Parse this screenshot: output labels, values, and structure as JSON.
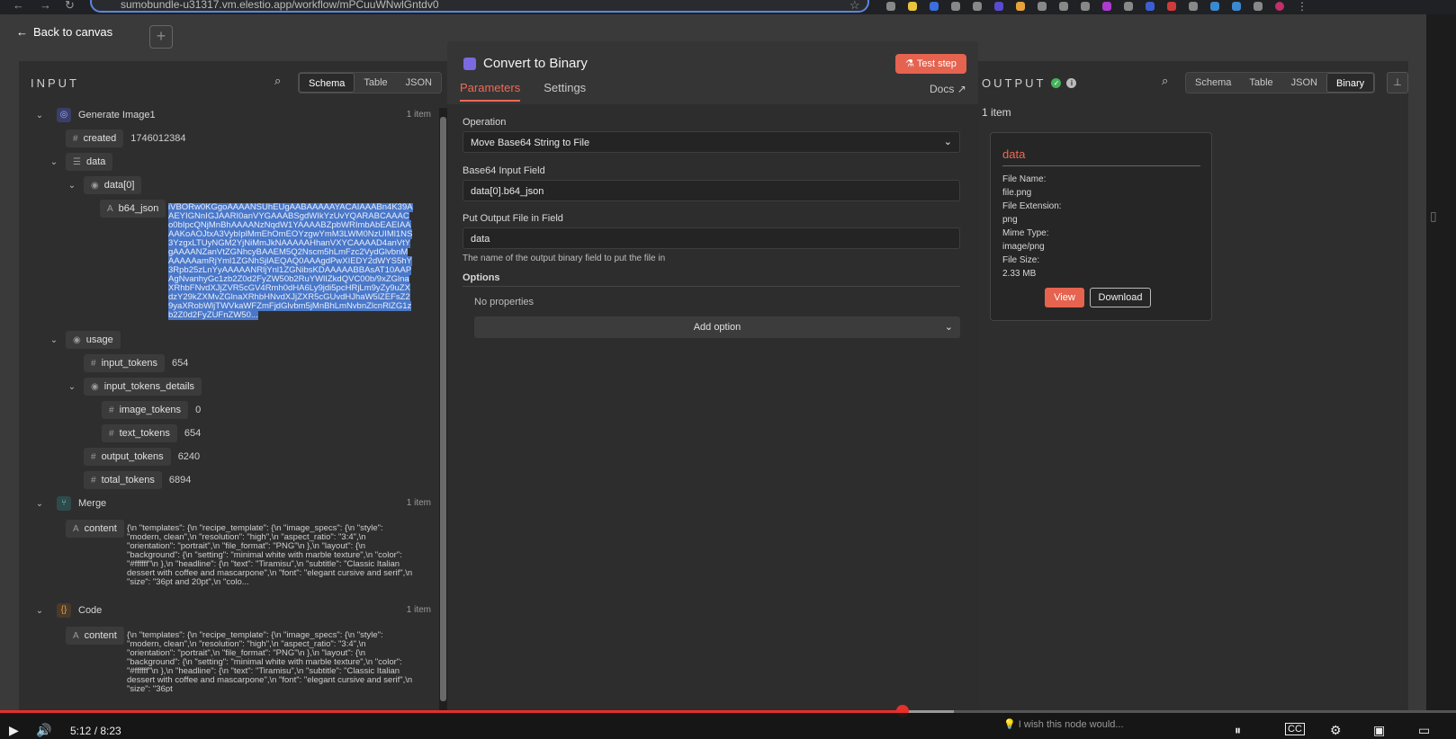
{
  "browser": {
    "url": "sumobundle-u31317.vm.elestio.app/workflow/mPCuuWNwlGntdv0"
  },
  "canvas": {
    "back_label": "Back to canvas"
  },
  "input_panel": {
    "title": "INPUT",
    "view_tabs": [
      "Schema",
      "Table",
      "JSON"
    ],
    "active_view": "Schema",
    "nodes": [
      {
        "name": "Generate Image1",
        "count": "1 item",
        "fields": {
          "created_key": "created",
          "created_val": "1746012384",
          "data_key": "data",
          "data0_key": "data[0]",
          "b64_key": "b64_json",
          "b64_val": "iVBORw0KGgoAAAANSUhEUgAABAAAAAYACAIAAABn4K39AAEYIGNnIGJAARI0anVYGAAABSgdWIkYzUvYQARABCAAACo0bIpcQNjMnBhAAAANzNqdW1YAAAABZpbWRImbAbEAEIAAAAKoAOJtxA3VybIplMmEhOmEOYzgwYmM3LWM0NzUIMl1NS3YzgxLTUyNGM2YjNiMmJkNAAAAAHhanVXYCAAAAD4anVtYgAAAANZanVtZGNhcyBAAEM5Q2Nscm5hLmFzc2VydGlvbnMAAAAAamRjYml1ZGNhSjlAEQAQ0AAAgdPwXIEDY2dWYS5hY3Rpb25zLnYyAAAAANRljYnl1ZGNibsKDAAAAABBAsAT10AAPAgNvanhyGc1zb2Z0d2FyZW50b2RuYWlIZkdQVC00b/9xZGlnaXRhbFNvdXJjZVR5cGV4Rmh0dHA6Ly9jdi5pcHRjLm9yZy9uZXdzY29kZXMvZGlnaXRhbHNvdXJjZXR5cGUvdHJhaW5lZEFsZ29yaXRobWljTWVkaWFZmFjdGlvbm5jMnBhLmNvbnZlcnRlZG1zb2Z0d2FyZUFnZW50..."
        }
      },
      {
        "usage_key": "usage",
        "input_tokens_key": "input_tokens",
        "input_tokens_val": "654",
        "input_tokens_details_key": "input_tokens_details",
        "image_tokens_key": "image_tokens",
        "image_tokens_val": "0",
        "text_tokens_key": "text_tokens",
        "text_tokens_val": "654",
        "output_tokens_key": "output_tokens",
        "output_tokens_val": "6240",
        "total_tokens_key": "total_tokens",
        "total_tokens_val": "6894"
      },
      {
        "name": "Merge",
        "count": "1 item",
        "content_key": "content",
        "content_val": "{\\n \"templates\": {\\n \"recipe_template\": {\\n \"image_specs\": {\\n \"style\": \"modern, clean\",\\n \"resolution\": \"high\",\\n \"aspect_ratio\": \"3:4\",\\n \"orientation\": \"portrait\",\\n \"file_format\": \"PNG\"\\n },\\n \"layout\": {\\n \"background\": {\\n \"setting\": \"minimal white with marble texture\",\\n \"color\": \"#ffffff\"\\n },\\n \"headline\": {\\n \"text\": \"Tiramisu\",\\n \"subtitle\": \"Classic Italian dessert with coffee and mascarpone\",\\n \"font\": \"elegant cursive and serif\",\\n \"size\": \"36pt and 20pt\",\\n \"colo..."
      },
      {
        "name": "Code",
        "count": "1 item",
        "content_key": "content",
        "content_val": "{\\n \"templates\": {\\n \"recipe_template\": {\\n \"image_specs\": {\\n \"style\": \"modern, clean\",\\n \"resolution\": \"high\",\\n \"aspect_ratio\": \"3:4\",\\n \"orientation\": \"portrait\",\\n \"file_format\": \"PNG\"\\n },\\n \"layout\": {\\n \"background\": {\\n \"setting\": \"minimal white with marble texture\",\\n \"color\": \"#ffffff\"\\n },\\n \"headline\": {\\n \"text\": \"Tiramisu\",\\n \"subtitle\": \"Classic Italian dessert with coffee and mascarpone\",\\n \"font\": \"elegant cursive and serif\",\\n \"size\": \"36pt"
      }
    ]
  },
  "node_panel": {
    "title": "Convert to Binary",
    "test_label": "Test step",
    "tabs": [
      "Parameters",
      "Settings"
    ],
    "active_tab": "Parameters",
    "docs_label": "Docs",
    "operation_label": "Operation",
    "operation_value": "Move Base64 String to File",
    "b64_field_label": "Base64 Input Field",
    "b64_field_value": "data[0].b64_json",
    "output_field_label": "Put Output File in Field",
    "output_field_value": "data",
    "output_field_hint": "The name of the output binary field to put the file in",
    "options_label": "Options",
    "no_properties": "No properties",
    "add_option": "Add option"
  },
  "output_panel": {
    "title": "OUTPUT",
    "view_tabs": [
      "Schema",
      "Table",
      "JSON",
      "Binary"
    ],
    "active_view": "Binary",
    "count": "1 item",
    "card": {
      "title": "data",
      "file_name_label": "File Name:",
      "file_name": "file.png",
      "file_ext_label": "File Extension:",
      "file_ext": "png",
      "mime_label": "Mime Type:",
      "mime": "image/png",
      "size_label": "File Size:",
      "size": "2.33 MB",
      "view_label": "View",
      "download_label": "Download"
    }
  },
  "player": {
    "time": "5:12 / 8:23",
    "progress_fraction": 0.62,
    "hint": "I wish this node would..."
  },
  "colors": {
    "accent": "#e5634f",
    "success": "#44b35a",
    "highlight": "#4a78c9"
  }
}
